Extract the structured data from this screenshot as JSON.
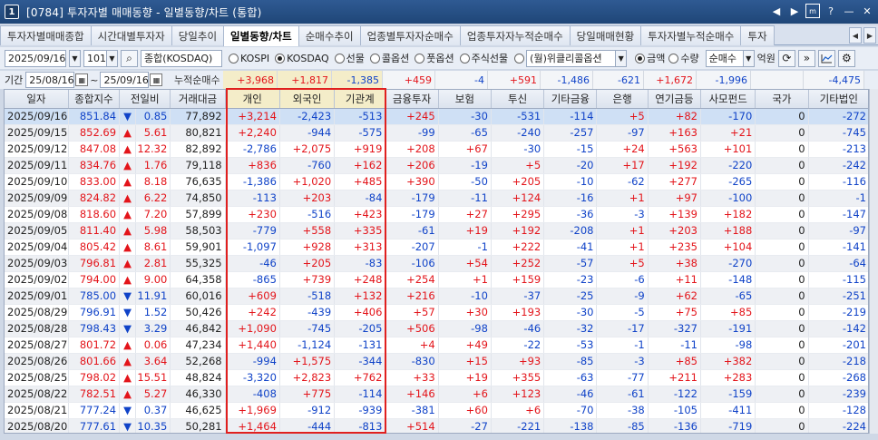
{
  "window": {
    "number": "1",
    "title": "[0784] 투자자별 매매동향 - 일별동향/차트 (통합)",
    "controls": [
      "◀",
      "▶",
      "m",
      "?",
      "—",
      "✕"
    ]
  },
  "tabs": [
    "투자자별매매종합",
    "시간대별투자자",
    "당일추이",
    "일별동향/차트",
    "순매수추이",
    "업종별투자자순매수",
    "업종투자자누적순매수",
    "당일매매현황",
    "투자자별누적순매수",
    "투자"
  ],
  "active_tab": "일별동향/차트",
  "toolbar": {
    "date": "2025/09/16",
    "code": "101",
    "market": "종합(KOSDAQ)",
    "radios": [
      {
        "label": "KOSPI",
        "checked": false
      },
      {
        "label": "KOSDAQ",
        "checked": true
      },
      {
        "label": "선물",
        "checked": false
      },
      {
        "label": "콜옵션",
        "checked": false
      },
      {
        "label": "풋옵션",
        "checked": false
      },
      {
        "label": "주식선물",
        "checked": false
      }
    ],
    "option_select": "(월)위클리콜옵션",
    "amount_radios": [
      {
        "label": "금액",
        "checked": true
      },
      {
        "label": "수량",
        "checked": false
      }
    ],
    "mode_select": "순매수",
    "unit": "억원"
  },
  "period": {
    "label": "기간",
    "start": "25/08/16",
    "sep": "~",
    "end": "25/09/16",
    "cumulative_label": "누적순매수",
    "totals": [
      "+3,968",
      "+1,817",
      "-1,385",
      "+459",
      "-4",
      "+591",
      "-1,486",
      "-621",
      "+1,672",
      "-1,996",
      "",
      "-4,475"
    ]
  },
  "columns": [
    "일자",
    "종합지수",
    "전일비",
    "거래대금",
    "개인",
    "외국인",
    "기관계",
    "금융투자",
    "보험",
    "투신",
    "기타금융",
    "은행",
    "연기금등",
    "사모펀드",
    "국가",
    "기타법인"
  ],
  "rows": [
    [
      "2025/09/16",
      "851.84",
      "▼",
      "0.85",
      "77,892",
      "+3,214",
      "-2,423",
      "-513",
      "+245",
      "-30",
      "-531",
      "-114",
      "+5",
      "+82",
      "-170",
      "0",
      "-272"
    ],
    [
      "2025/09/15",
      "852.69",
      "▲",
      "5.61",
      "80,821",
      "+2,240",
      "-944",
      "-575",
      "-99",
      "-65",
      "-240",
      "-257",
      "-97",
      "+163",
      "+21",
      "0",
      "-745"
    ],
    [
      "2025/09/12",
      "847.08",
      "▲",
      "12.32",
      "82,892",
      "-2,786",
      "+2,075",
      "+919",
      "+208",
      "+67",
      "-30",
      "-15",
      "+24",
      "+563",
      "+101",
      "0",
      "-213"
    ],
    [
      "2025/09/11",
      "834.76",
      "▲",
      "1.76",
      "79,118",
      "+836",
      "-760",
      "+162",
      "+206",
      "-19",
      "+5",
      "-20",
      "+17",
      "+192",
      "-220",
      "0",
      "-242"
    ],
    [
      "2025/09/10",
      "833.00",
      "▲",
      "8.18",
      "76,635",
      "-1,386",
      "+1,020",
      "+485",
      "+390",
      "-50",
      "+205",
      "-10",
      "-62",
      "+277",
      "-265",
      "0",
      "-116"
    ],
    [
      "2025/09/09",
      "824.82",
      "▲",
      "6.22",
      "74,850",
      "-113",
      "+203",
      "-84",
      "-179",
      "-11",
      "+124",
      "-16",
      "+1",
      "+97",
      "-100",
      "0",
      "-1"
    ],
    [
      "2025/09/08",
      "818.60",
      "▲",
      "7.20",
      "57,899",
      "+230",
      "-516",
      "+423",
      "-179",
      "+27",
      "+295",
      "-36",
      "-3",
      "+139",
      "+182",
      "0",
      "-147"
    ],
    [
      "2025/09/05",
      "811.40",
      "▲",
      "5.98",
      "58,503",
      "-779",
      "+558",
      "+335",
      "-61",
      "+19",
      "+192",
      "-208",
      "+1",
      "+203",
      "+188",
      "0",
      "-97"
    ],
    [
      "2025/09/04",
      "805.42",
      "▲",
      "8.61",
      "59,901",
      "-1,097",
      "+928",
      "+313",
      "-207",
      "-1",
      "+222",
      "-41",
      "+1",
      "+235",
      "+104",
      "0",
      "-141"
    ],
    [
      "2025/09/03",
      "796.81",
      "▲",
      "2.81",
      "55,325",
      "-46",
      "+205",
      "-83",
      "-106",
      "+54",
      "+252",
      "-57",
      "+5",
      "+38",
      "-270",
      "0",
      "-64"
    ],
    [
      "2025/09/02",
      "794.00",
      "▲",
      "9.00",
      "64,358",
      "-865",
      "+739",
      "+248",
      "+254",
      "+1",
      "+159",
      "-23",
      "-6",
      "+11",
      "-148",
      "0",
      "-115"
    ],
    [
      "2025/09/01",
      "785.00",
      "▼",
      "11.91",
      "60,016",
      "+609",
      "-518",
      "+132",
      "+216",
      "-10",
      "-37",
      "-25",
      "-9",
      "+62",
      "-65",
      "0",
      "-251"
    ],
    [
      "2025/08/29",
      "796.91",
      "▼",
      "1.52",
      "50,426",
      "+242",
      "-439",
      "+406",
      "+57",
      "+30",
      "+193",
      "-30",
      "-5",
      "+75",
      "+85",
      "0",
      "-219"
    ],
    [
      "2025/08/28",
      "798.43",
      "▼",
      "3.29",
      "46,842",
      "+1,090",
      "-745",
      "-205",
      "+506",
      "-98",
      "-46",
      "-32",
      "-17",
      "-327",
      "-191",
      "0",
      "-142"
    ],
    [
      "2025/08/27",
      "801.72",
      "▲",
      "0.06",
      "47,234",
      "+1,440",
      "-1,124",
      "-131",
      "+4",
      "+49",
      "-22",
      "-53",
      "-1",
      "-11",
      "-98",
      "0",
      "-201"
    ],
    [
      "2025/08/26",
      "801.66",
      "▲",
      "3.64",
      "52,268",
      "-994",
      "+1,575",
      "-344",
      "-830",
      "+15",
      "+93",
      "-85",
      "-3",
      "+85",
      "+382",
      "0",
      "-218"
    ],
    [
      "2025/08/25",
      "798.02",
      "▲",
      "15.51",
      "48,824",
      "-3,320",
      "+2,823",
      "+762",
      "+33",
      "+19",
      "+355",
      "-63",
      "-77",
      "+211",
      "+283",
      "0",
      "-268"
    ],
    [
      "2025/08/22",
      "782.51",
      "▲",
      "5.27",
      "46,330",
      "-408",
      "+775",
      "-114",
      "+146",
      "+6",
      "+123",
      "-46",
      "-61",
      "-122",
      "-159",
      "0",
      "-239"
    ],
    [
      "2025/08/21",
      "777.24",
      "▼",
      "0.37",
      "46,625",
      "+1,969",
      "-912",
      "-939",
      "-381",
      "+60",
      "+6",
      "-70",
      "-38",
      "-105",
      "-411",
      "0",
      "-128"
    ],
    [
      "2025/08/20",
      "777.61",
      "▼",
      "10.35",
      "50,281",
      "+1,464",
      "-444",
      "-813",
      "+514",
      "-27",
      "-221",
      "-138",
      "-85",
      "-136",
      "-719",
      "0",
      "-224"
    ]
  ]
}
